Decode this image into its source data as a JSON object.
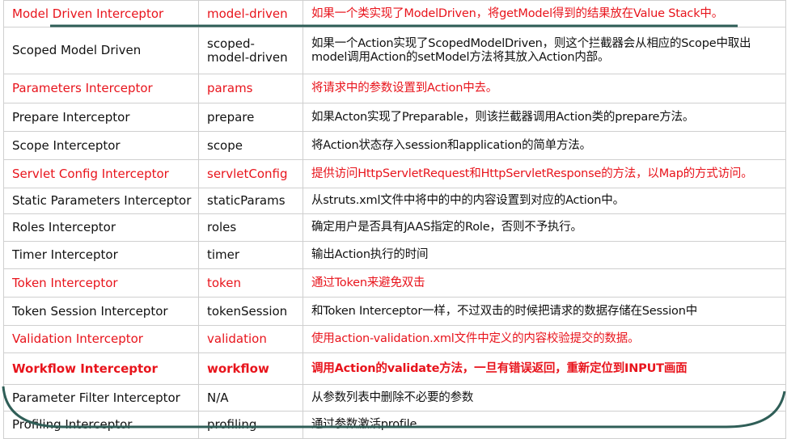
{
  "colors": {
    "highlight": "#e8141c",
    "text": "#111111",
    "grid": "#cfcfcf",
    "frame": "#2f5e57"
  },
  "rows": [
    {
      "name": "Model Driven Interceptor",
      "key": "model-driven",
      "desc": "如果一个类实现了ModelDriven，将getModel得到的结果放在Value Stack中。",
      "highlight": true
    },
    {
      "name": "Scoped Model Driven",
      "key": "scoped-model-driven",
      "desc": "如果一个Action实现了ScopedModelDriven，则这个拦截器会从相应的Scope中取出model调用Action的setModel方法将其放入Action内部。"
    },
    {
      "name": "Parameters Interceptor",
      "key": "params",
      "desc": "将请求中的参数设置到Action中去。",
      "highlight": true
    },
    {
      "name": "Prepare Interceptor",
      "key": "prepare",
      "desc": "如果Acton实现了Preparable，则该拦截器调用Action类的prepare方法。"
    },
    {
      "name": "Scope Interceptor",
      "key": "scope",
      "desc": "将Action状态存入session和application的简单方法。"
    },
    {
      "name": "Servlet Config Interceptor",
      "key": "servletConfig",
      "desc": "提供访问HttpServletRequest和HttpServletResponse的方法，以Map的方式访问。",
      "highlight": true
    },
    {
      "name": "Static Parameters Interceptor",
      "key": "staticParams",
      "desc": "从struts.xml文件中将中的中的内容设置到对应的Action中。"
    },
    {
      "name": "Roles Interceptor",
      "key": "roles",
      "desc": "确定用户是否具有JAAS指定的Role，否则不予执行。"
    },
    {
      "name": "Timer Interceptor",
      "key": "timer",
      "desc": "输出Action执行的时间"
    },
    {
      "name": "Token Interceptor",
      "key": "token",
      "desc": "通过Token来避免双击",
      "highlight": true
    },
    {
      "name": "Token Session Interceptor",
      "key": "tokenSession",
      "desc": "和Token Interceptor一样，不过双击的时候把请求的数据存储在Session中"
    },
    {
      "name": "Validation Interceptor",
      "key": "validation",
      "desc": "使用action-validation.xml文件中定义的内容校验提交的数据。",
      "highlight": true
    },
    {
      "name": "Workflow Interceptor",
      "key": "workflow",
      "desc": "调用Action的validate方法，一旦有错误返回，重新定位到INPUT画面",
      "highlight": true,
      "bold": true
    },
    {
      "name": "Parameter Filter Interceptor",
      "key": "N/A",
      "desc": "从参数列表中删除不必要的参数"
    },
    {
      "name": "Profiling Interceptor",
      "key": "profiling",
      "desc": "通过参数激活profile"
    }
  ]
}
